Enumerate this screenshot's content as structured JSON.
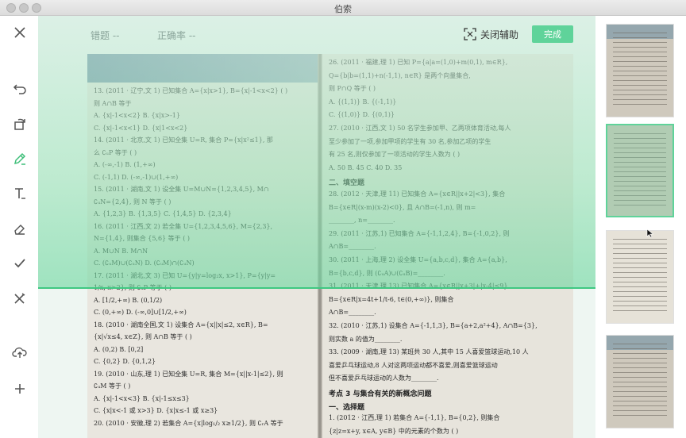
{
  "window": {
    "title": "伯索"
  },
  "toolbar": {
    "items": [
      {
        "name": "close-icon"
      },
      {
        "name": "undo-icon"
      },
      {
        "name": "rotate-icon"
      },
      {
        "name": "pen-icon"
      },
      {
        "name": "text-icon"
      },
      {
        "name": "eraser-icon"
      },
      {
        "name": "check-icon"
      },
      {
        "name": "wrong-mark-icon"
      },
      {
        "name": "cloud-upload-icon"
      },
      {
        "name": "add-icon"
      }
    ]
  },
  "header": {
    "wrong_label": "错题 --",
    "accuracy_label": "正确率 --",
    "assist_label": "关闭辅助",
    "done_label": "完成"
  },
  "colors": {
    "accent": "#5fd39a",
    "scanline": "#3fc882"
  },
  "document": {
    "left_lines": [
      "13. (2011 · 辽宁,文 1) 已知集合 A={x|x>1}, B={x|-1<x<2}  (    )",
      "则 A∩B 等于",
      "A. {x|-1<x<2}          B. {x|x>-1}",
      "C. {x|-1<x<1}          D. {x|1<x<2}",
      "14. (2011 · 北京,文 1) 已知全集 U=R, 集合 P={x|x²≤1}, 那",
      "么 ∁ᵤP 等于  (    )",
      "A. (-∞,-1)             B. (1,+∞)",
      "C. (-1,1)              D. (-∞,-1)∪(1,+∞)",
      "15. (2011 · 湖南,文 1) 设全集 U=M∪N={1,2,3,4,5}, M∩",
      "∁ᵤN={2,4}, 则 N 等于  (    )",
      "A. {1,2,3}   B. {1,3,5}   C. {1,4,5}   D. {2,3,4}",
      "16. (2011 · 江西,文 2) 若全集 U={1,2,3,4,5,6}, M={2,3},",
      "N={1,4}, 则集合 {5,6} 等于  (    )",
      "A. M∪N                 B. M∩N",
      "C. (∁ᵤM)∪(∁ᵤN)          D. (∁ᵤM)∩(∁ᵤN)",
      "17. (2011 · 湖北,文 3) 已知 U={y|y=log₂x, x>1}, P={y|y=",
      "1/x, x>2}, 则 ∁ᵤP 等于  (    )",
      "A. [1/2,+∞)            B. (0,1/2)",
      "C. (0,+∞)              D. (-∞,0]∪[1/2,+∞)",
      "18. (2010 · 湖南全国,文 1) 设集合 A={x||x|≤2, x∈R}, B=",
      "{x|√x≤4, x∈Z}, 则 A∩B 等于  (    )",
      "A. (0,2)               B. [0,2]",
      "C. {0,2}               D. {0,1,2}",
      "19. (2010 · 山东,理 1) 已知全集 U=R, 集合 M={x||x-1|≤2}, 则",
      "∁ᵤM 等于  (    )",
      "A. {x|-1<x<3}          B. {x|-1≤x≤3}",
      "C. {x|x<-1 或 x>3}      D. {x|x≤-1 或 x≥3}",
      "20. (2010 · 安徽,理 2) 若集合 A={x|log₁/₂ x≥1/2}, 则 ∁ᵣA 等于"
    ],
    "right_lines": [
      "26. (2011 · 福建,理 1) 已知 P={a|a=(1,0)+m(0,1), m∈R},",
      "Q={b|b=(1,1)+n(-1,1), n∈R} 是两个向量集合,",
      "则 P∩Q 等于  (    )",
      "A. {(1,1)}              B. {(-1,1)}",
      "C. {(1,0)}              D. {(0,1)}",
      "27. (2010 · 江西,文 1) 50 名学生参加甲、乙两项体育活动,每人",
      "至少参加了一项,参加甲项的学生有 30 名,参加乙项的学生",
      "有 25 名,则仅参加了一项活动的学生人数为  (    )",
      "A. 50        B. 45        C. 40        D. 35",
      "二、填空题",
      "28. (2012 · 天津,理 11) 已知集合 A={x∈R||x+2|<3}, 集合",
      "B={x∈R|(x-m)(x-2)<0}, 且 A∩B=(-1,n), 则 m=",
      "________, n=________.",
      "29. (2011 · 江苏,1) 已知集合 A={-1,1,2,4}, B={-1,0,2}, 则",
      "A∩B=________.",
      "30. (2011 · 上海,理 2) 设全集 U={a,b,c,d}, 集合 A={a,b},",
      "B={b,c,d}, 则 (∁ᵤA)∪(∁ᵤB)=________.",
      "31. (2011 · 天津,理 13) 已知集合 A={x∈R||x+3|+|x-4|≤9},",
      "B={x∈R|x=4t+1/t-6, t∈(0,+∞)}, 则集合",
      "A∩B=________.",
      "32. (2010 · 江苏,1) 设集合 A={-1,1,3}, B={a+2,a²+4}, A∩B={3},",
      "则实数 a 的值为________.",
      "33. (2009 · 湖南,理 13) 某班共 30 人,其中 15 人喜爱篮球运动,10 人",
      "喜爱乒乓球运动,8 人对这两项运动都不喜爱,则喜爱篮球运动",
      "但不喜爱乒乓球运动的人数为________.",
      "考点 3  与集合有关的新概念问题",
      "一、选择题",
      "1. (2012 · 江西,理 1) 若集合 A={-1,1}, B={0,2}, 则集合",
      "{z|z=x+y, x∈A, y∈B} 中的元素的个数为  (    )"
    ]
  }
}
